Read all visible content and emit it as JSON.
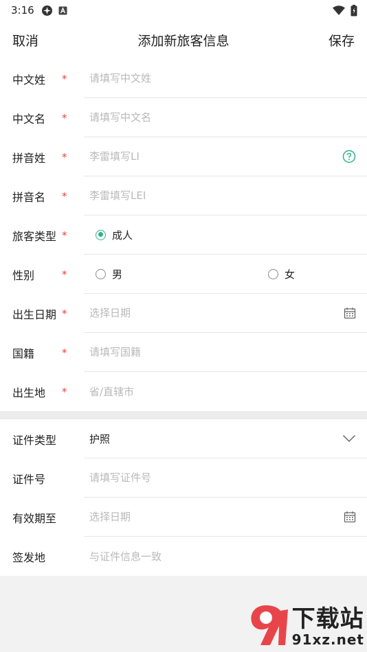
{
  "status_bar": {
    "time": "3:16",
    "icons": [
      "game-icon",
      "app-a-icon",
      "wifi-icon",
      "battery-icon"
    ]
  },
  "nav": {
    "cancel": "取消",
    "title": "添加新旅客信息",
    "save": "保存"
  },
  "form": {
    "cn_surname": {
      "label": "中文姓",
      "required": "*",
      "placeholder": "请填写中文姓"
    },
    "cn_given": {
      "label": "中文名",
      "required": "*",
      "placeholder": "请填写中文名"
    },
    "py_surname": {
      "label": "拼音姓",
      "required": "*",
      "placeholder": "李雷填写LI",
      "icon": "help-circle-icon"
    },
    "py_given": {
      "label": "拼音名",
      "required": "*",
      "placeholder": "李雷填写LEI"
    },
    "traveler_type": {
      "label": "旅客类型",
      "required": "*",
      "option": "成人"
    },
    "gender": {
      "label": "性别",
      "required": "*",
      "male": "男",
      "female": "女"
    },
    "birth_date": {
      "label": "出生日期",
      "required": "*",
      "placeholder": "选择日期",
      "icon": "calendar-icon"
    },
    "nationality": {
      "label": "国籍",
      "required": "*",
      "placeholder": "请填写国籍"
    },
    "birthplace": {
      "label": "出生地",
      "required": "*",
      "placeholder": "省/直辖市"
    }
  },
  "document": {
    "doc_type": {
      "label": "证件类型",
      "value": "护照",
      "icon": "chevron-down-icon"
    },
    "doc_number": {
      "label": "证件号",
      "placeholder": "请填写证件号"
    },
    "expiry": {
      "label": "有效期至",
      "placeholder": "选择日期",
      "icon": "calendar-icon"
    },
    "issue_place": {
      "label": "签发地",
      "placeholder": "与证件信息一致"
    }
  },
  "watermark": {
    "cn": "下载站",
    "en": "91xz.net"
  },
  "colors": {
    "accent": "#2bb38c",
    "required": "#e8453c",
    "placeholder": "#b9b9b9"
  }
}
